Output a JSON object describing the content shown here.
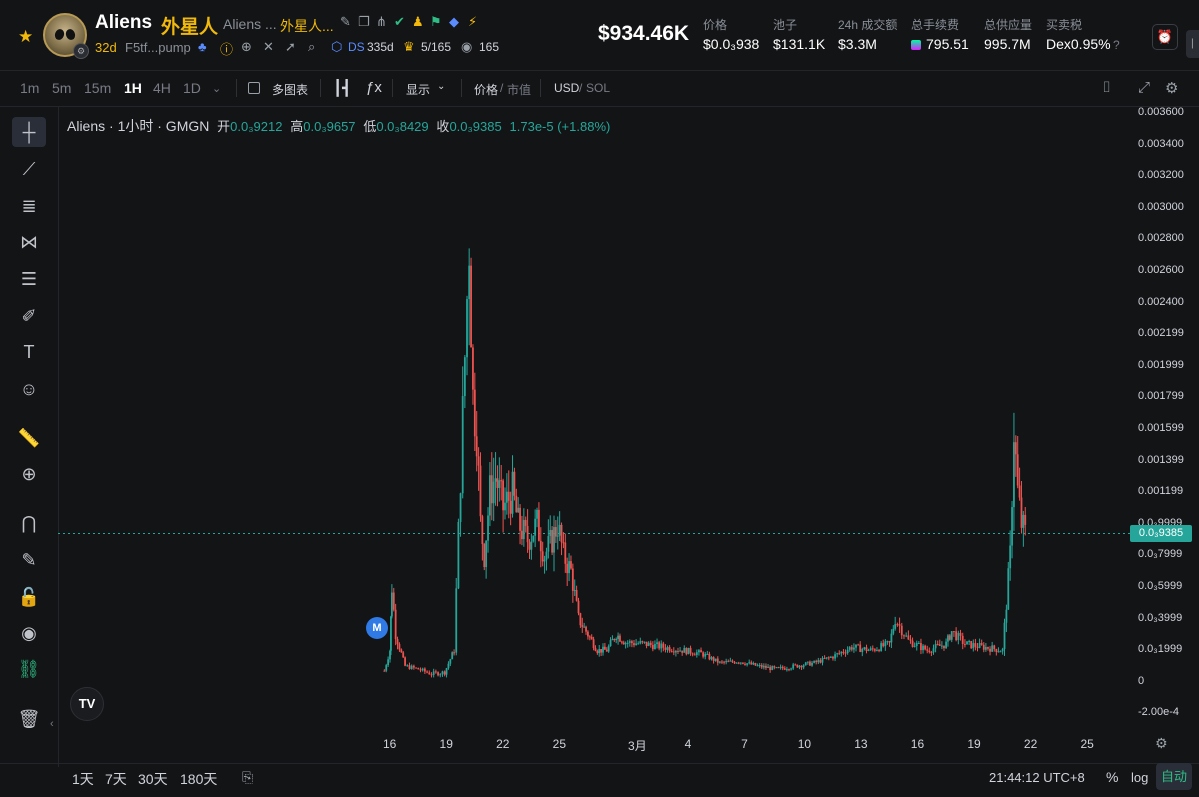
{
  "token": {
    "symbol": "Aliens",
    "name_cn": "外星人",
    "full_name": "Aliens ...",
    "full_name_cn": "外星人...",
    "age": "32d",
    "address": "F5tf...pump",
    "ds_label": "DS",
    "ds_value": "335d",
    "holders": "5/165",
    "watchers": "165"
  },
  "stats": {
    "market_cap": "$934.46K",
    "items": [
      {
        "label": "价格",
        "value": "$0.0₃938"
      },
      {
        "label": "池子",
        "value": "$131.1K"
      },
      {
        "label": "24h 成交额",
        "value": "$3.3M"
      },
      {
        "label": "总手续费",
        "value": "795.51"
      },
      {
        "label": "总供应量",
        "value": "995.7M"
      },
      {
        "label": "买卖税",
        "value": "Dex0.95%"
      }
    ]
  },
  "toolbar": {
    "timeframes": [
      "1m",
      "5m",
      "15m",
      "1H",
      "4H",
      "1D"
    ],
    "active_timeframe": "1H",
    "multi_chart": "多图表",
    "fx": "ƒx",
    "display": "显示",
    "price_label": "价格",
    "mcap_label": "市值",
    "usd_label": "USD",
    "sol_label": "SOL"
  },
  "legend": {
    "title": "Aliens · 1小时 · GMGN",
    "open_label": "开",
    "open": "0.0₃9212",
    "high_label": "高",
    "high": "0.0₃9657",
    "low_label": "低",
    "low": "0.0₃8429",
    "close_label": "收",
    "close": "0.0₃9385",
    "change": "1.73e-5 (+1.88%)"
  },
  "chart_data": {
    "type": "candlestick",
    "title": "Aliens · 1小时 · GMGN",
    "y_ticks": [
      "0.003600",
      "0.003400",
      "0.003200",
      "0.003000",
      "0.002800",
      "0.002600",
      "0.002400",
      "0.002199",
      "0.001999",
      "0.001799",
      "0.001599",
      "0.001399",
      "0.001199",
      "0.0₃9999",
      "0.0₃7999",
      "0.0₃5999",
      "0.0₃3999",
      "0.0₃1999",
      "0",
      "-2.00e-4"
    ],
    "x_ticks": [
      "16",
      "19",
      "22",
      "25",
      "3月",
      "4",
      "7",
      "10",
      "13",
      "16",
      "19",
      "22",
      "25"
    ],
    "ylim": [
      -0.0002,
      0.0036
    ],
    "current_price": "0.0₃9385",
    "x_days": [
      15.7,
      16.0,
      16.1,
      16.3,
      16.8,
      17.5,
      18.2,
      18.9,
      19.4,
      20.2,
      20.4,
      20.6,
      20.8,
      21.0,
      21.3,
      21.6,
      22.0,
      22.5,
      22.8,
      23.3,
      23.8,
      24.2,
      24.6,
      24.9,
      25.2,
      25.6,
      26.0,
      26.5,
      27.0,
      27.5,
      28.0,
      28.5,
      29.5,
      30.5,
      31.5,
      32.5,
      33.5,
      34.5,
      35.5,
      36.5,
      37.5,
      38.5,
      39.5,
      40.5,
      41.5,
      42.5,
      42.8,
      43.5,
      44.5,
      45.5,
      45.8,
      46.5,
      47.5,
      48.5,
      48.9,
      49.1,
      49.3,
      49.5,
      49.7
    ],
    "close": [
      7e-05,
      0.0002,
      0.0006,
      0.0003,
      0.0001,
      8e-05,
      5e-05,
      6e-05,
      0.0002,
      0.0028,
      0.0018,
      0.0016,
      0.001,
      0.0008,
      0.0012,
      0.0013,
      0.0011,
      0.0012,
      0.001,
      0.0009,
      0.001,
      0.0008,
      0.0009,
      0.001,
      0.0008,
      0.0007,
      0.0004,
      0.0003,
      0.0002,
      0.0002,
      0.0003,
      0.00025,
      0.00024,
      0.00022,
      0.0002,
      0.00018,
      0.00012,
      0.00013,
      0.0001,
      8e-05,
      0.0001,
      0.00012,
      0.00016,
      0.00022,
      0.0002,
      0.00024,
      0.0004,
      0.00026,
      0.0002,
      0.00024,
      0.00032,
      0.00024,
      0.00022,
      0.0002,
      0.0008,
      0.0016,
      0.0012,
      0.001,
      0.0009385
    ]
  },
  "bottom": {
    "ranges": [
      "1天",
      "7天",
      "30天",
      "180天"
    ],
    "clock": "21:44:12 UTC+8",
    "percent": "%",
    "log": "log",
    "auto": "自动"
  },
  "marker": "M",
  "colors": {
    "up": "#26a69a",
    "down": "#ef5350",
    "accent": "#f0b90b"
  }
}
